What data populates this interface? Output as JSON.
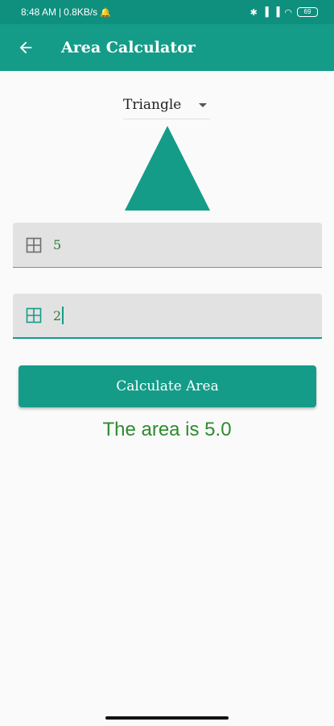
{
  "status_bar": {
    "time": "8:48 AM",
    "network_speed": "0.8KB/s",
    "battery": "69"
  },
  "app_bar": {
    "title": "Area Calculator",
    "back_icon": "arrow-back-icon"
  },
  "shape_selector": {
    "selected": "Triangle"
  },
  "shape_preview": {
    "shape": "triangle",
    "color": "#149c89"
  },
  "inputs": [
    {
      "value": "5",
      "icon": "grid-icon"
    },
    {
      "value": "2",
      "icon": "grid-icon"
    }
  ],
  "calculate_button": {
    "label": "Calculate Area"
  },
  "result": {
    "text": "The area is 5.0"
  },
  "colors": {
    "primary": "#149c89",
    "status_bar": "#0f8f7e",
    "result_text": "#2e8b2e"
  }
}
